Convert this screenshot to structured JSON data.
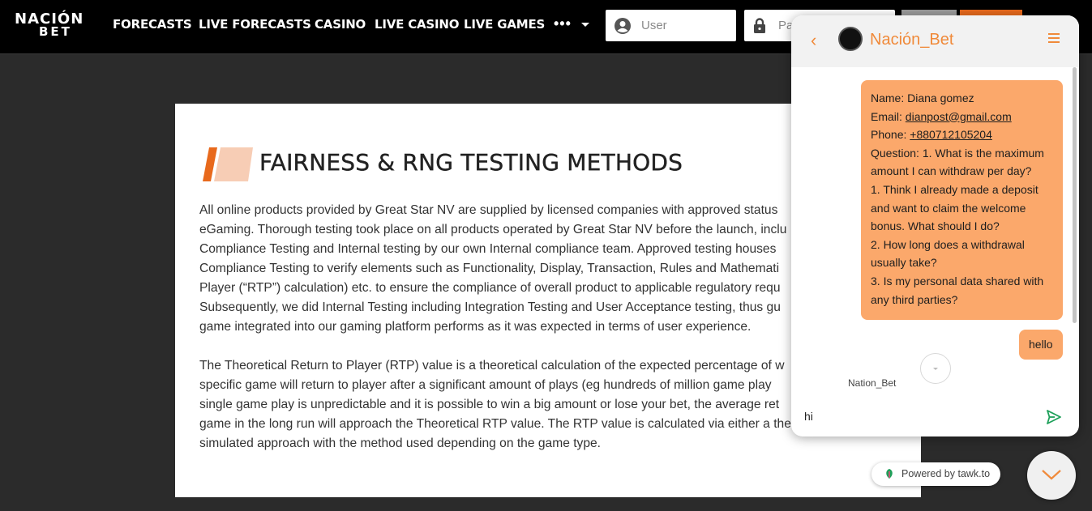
{
  "header": {
    "logo_line1": "NACIÓN",
    "logo_line2": "BET",
    "nav": [
      "FORECASTS",
      "LIVE FORECASTS",
      "CASINO",
      "LIVE CASINO",
      "LIVE GAMES"
    ],
    "more_label": "•••",
    "user_placeholder": "User",
    "password_placeholder": "Pa"
  },
  "content": {
    "title": "FAIRNESS & RNG TESTING METHODS",
    "paragraph1": [
      "All online products provided by Great Star NV are supplied by licensed companies with approved status",
      "eGaming. Thorough testing took place on all products operated by Great Star NV before the launch, inclu",
      "Compliance Testing and Internal testing by our own Internal compliance team. Approved testing houses",
      "Compliance Testing to verify elements such as Functionality, Display, Transaction, Rules and Mathemati",
      "Player (“RTP”) calculation) etc. to ensure the compliance of overall product to applicable regulatory requ",
      "Subsequently, we did Internal Testing including Integration Testing and User Acceptance testing, thus gu",
      "game integrated into our gaming platform performs as it was expected in terms of user experience."
    ],
    "paragraph2": [
      "The Theoretical Return to Player (RTP) value is a theoretical calculation of the expected percentage of w",
      "specific game will return to player after a significant amount of plays (eg hundreds of million game play",
      "single game play is unpredictable and it is possible to win a big amount or lose your bet, the average ret",
      "game in the long run will approach the Theoretical RTP value. The RTP value is calculated via either a the",
      "simulated approach with the method used depending on the game type."
    ]
  },
  "chat": {
    "name": "Nación_Bet",
    "back_icon": "‹",
    "message_lines": [
      {
        "pre": "Name: Diana gomez",
        "link": ""
      },
      {
        "pre": "Email: ",
        "link": "dianpost@gmail.com"
      },
      {
        "pre": "Phone: ",
        "link": "+880712105204"
      },
      {
        "pre": "Question: 1. What is the maximum",
        "link": ""
      },
      {
        "pre": "amount I can withdraw per day?",
        "link": ""
      },
      {
        "pre": "1. Think I already made a deposit",
        "link": ""
      },
      {
        "pre": "and want to claim the welcome",
        "link": ""
      },
      {
        "pre": "bonus. What should I do?",
        "link": ""
      },
      {
        "pre": "2. How long does a withdrawal",
        "link": ""
      },
      {
        "pre": "usually take?",
        "link": ""
      },
      {
        "pre": "3. Is my personal data shared with",
        "link": ""
      },
      {
        "pre": "any third parties?",
        "link": ""
      }
    ],
    "hello": "hello",
    "agent_label": "Nation_Bet",
    "input_value": "hi",
    "powered_by": "Powered by tawk.to"
  },
  "colors": {
    "accent": "#f08a3a",
    "bubble": "#fba86b",
    "header_bg": "#000000",
    "page_bg": "#2b2b2b"
  }
}
